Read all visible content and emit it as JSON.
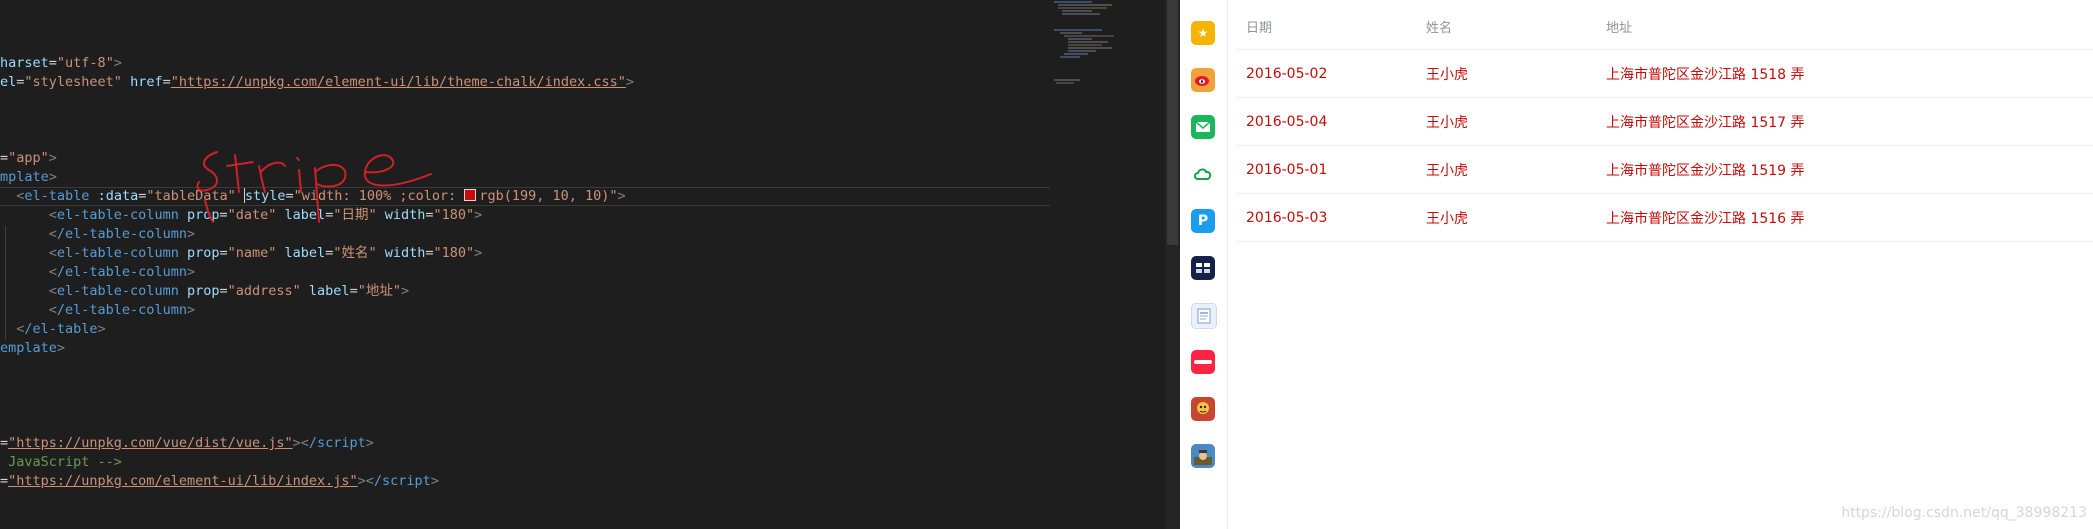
{
  "editor": {
    "lines": {
      "l1_attr": "harset",
      "l1_val": "\"utf-8\"",
      "l2_attr": "el",
      "l2_val": "\"stylesheet\"",
      "l2_attr2": "href",
      "l2_url": "\"https://unpkg.com/element-ui/lib/theme-chalk/index.css\"",
      "l3_val": "\"app\"",
      "l4_tag": "mplate",
      "l5_tag": "el-table",
      "l5_attr1": ":data",
      "l5_val1": "\"tableData\"",
      "l5_attr2": "style",
      "l5_val2a": "\"width: 100% ;color: ",
      "l5_val2b": "rgb(199, 10, 10)\"",
      "col_tag": "el-table-column",
      "col_close": "/el-table-column",
      "prop_attr": "prop",
      "label_attr": "label",
      "width_attr": "width",
      "c1_prop": "\"date\"",
      "c1_label": "\"日期\"",
      "c1_width": "\"180\"",
      "c2_prop": "\"name\"",
      "c2_label": "\"姓名\"",
      "c2_width": "\"180\"",
      "c3_prop": "\"address\"",
      "c3_label": "\"地址\"",
      "table_close": "/el-table",
      "tpl_close": "emplate",
      "s1_url": "\"https://unpkg.com/vue/dist/vue.js\"",
      "s1_close": "/script",
      "comment": " JavaScript -->",
      "s2_url": "\"https://unpkg.com/element-ui/lib/index.js\"",
      "s2_close": "/script"
    }
  },
  "sidebar": {
    "icons": [
      "star-icon",
      "weibo-icon",
      "mail-icon",
      "cloud-icon",
      "p-app-icon",
      "news-app-icon",
      "document-icon",
      "xiaohongshu-icon",
      "game-icon",
      "game2-icon"
    ]
  },
  "table": {
    "headers": [
      "日期",
      "姓名",
      "地址"
    ],
    "rows": [
      {
        "date": "2016-05-02",
        "name": "王小虎",
        "address": "上海市普陀区金沙江路 1518 弄"
      },
      {
        "date": "2016-05-04",
        "name": "王小虎",
        "address": "上海市普陀区金沙江路 1517 弄"
      },
      {
        "date": "2016-05-01",
        "name": "王小虎",
        "address": "上海市普陀区金沙江路 1519 弄"
      },
      {
        "date": "2016-05-03",
        "name": "王小虎",
        "address": "上海市普陀区金沙江路 1516 弄"
      }
    ],
    "text_color": "#c70a0a"
  },
  "watermark": "https://blog.csdn.net/qq_38998213"
}
